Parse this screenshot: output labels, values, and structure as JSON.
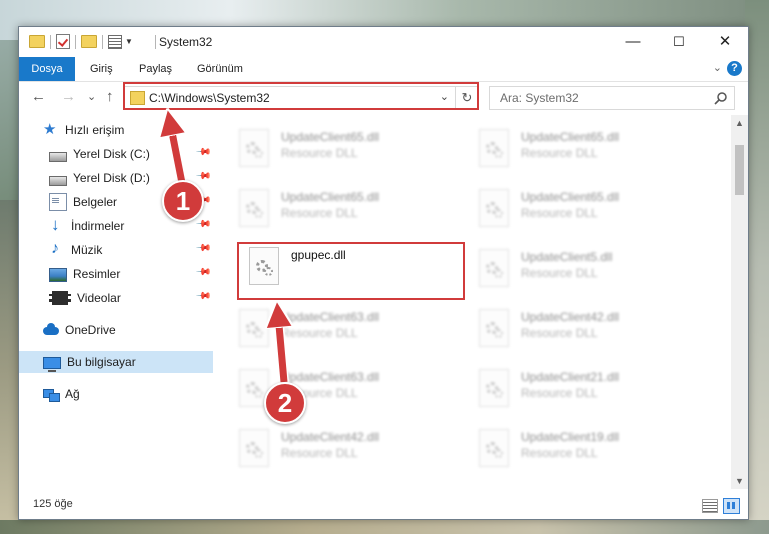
{
  "window": {
    "title": "System32",
    "controls": {
      "minimize": "—",
      "maximize": "☐",
      "close": "✕"
    }
  },
  "ribbon": {
    "tabs": [
      "Dosya",
      "Giriş",
      "Paylaş",
      "Görünüm"
    ],
    "collapse": "⌄",
    "help": "?"
  },
  "navigation": {
    "back": "←",
    "forward": "→",
    "recent": "⌄",
    "up": "↑",
    "address": "C:\\Windows\\System32",
    "address_dropdown": "⌄",
    "refresh": "↻",
    "search_placeholder": "Ara: System32"
  },
  "sidebar": {
    "items": [
      {
        "label": "Hızlı erişim",
        "icon": "star-icon",
        "pinned": false
      },
      {
        "label": "Yerel Disk (C:)",
        "icon": "disk-icon",
        "pinned": true
      },
      {
        "label": "Yerel Disk (D:)",
        "icon": "disk-icon",
        "pinned": true
      },
      {
        "label": "Belgeler",
        "icon": "documents-icon",
        "pinned": true
      },
      {
        "label": "İndirmeler",
        "icon": "download-icon",
        "pinned": true
      },
      {
        "label": "Müzik",
        "icon": "music-icon",
        "pinned": true
      },
      {
        "label": "Resimler",
        "icon": "pictures-icon",
        "pinned": true
      },
      {
        "label": "Videolar",
        "icon": "videos-icon",
        "pinned": true
      },
      {
        "label": "OneDrive",
        "icon": "onedrive-icon",
        "pinned": false
      },
      {
        "label": "Bu bilgisayar",
        "icon": "computer-icon",
        "pinned": false,
        "selected": true
      },
      {
        "label": "Ağ",
        "icon": "network-icon",
        "pinned": false
      }
    ],
    "pin_glyph": "📌"
  },
  "files": {
    "left_column": [
      {
        "name": "UpdateClient65.dll",
        "type": "Resource DLL"
      },
      {
        "name": "UpdateClient65.dll",
        "type": "Resource DLL"
      },
      {
        "name": "gpupec.dll",
        "type": ""
      },
      {
        "name": "UpdateClient63.dll",
        "type": "Resource DLL"
      },
      {
        "name": "UpdateClient63.dll",
        "type": "Resource DLL"
      },
      {
        "name": "UpdateClient42.dll",
        "type": "Resource DLL"
      }
    ],
    "right_column": [
      {
        "name": "UpdateClient65.dll",
        "type": "Resource DLL"
      },
      {
        "name": "UpdateClient65.dll",
        "type": "Resource DLL"
      },
      {
        "name": "UpdateClient5.dll",
        "type": "Resource DLL"
      },
      {
        "name": "UpdateClient42.dll",
        "type": "Resource DLL"
      },
      {
        "name": "UpdateClient21.dll",
        "type": "Resource DLL"
      },
      {
        "name": "UpdateClient19.dll",
        "type": "Resource DLL"
      }
    ]
  },
  "status": {
    "count": "125 öğe"
  },
  "annotations": {
    "badge1": "1",
    "badge2": "2",
    "highlight_color": "#d13b3b"
  }
}
